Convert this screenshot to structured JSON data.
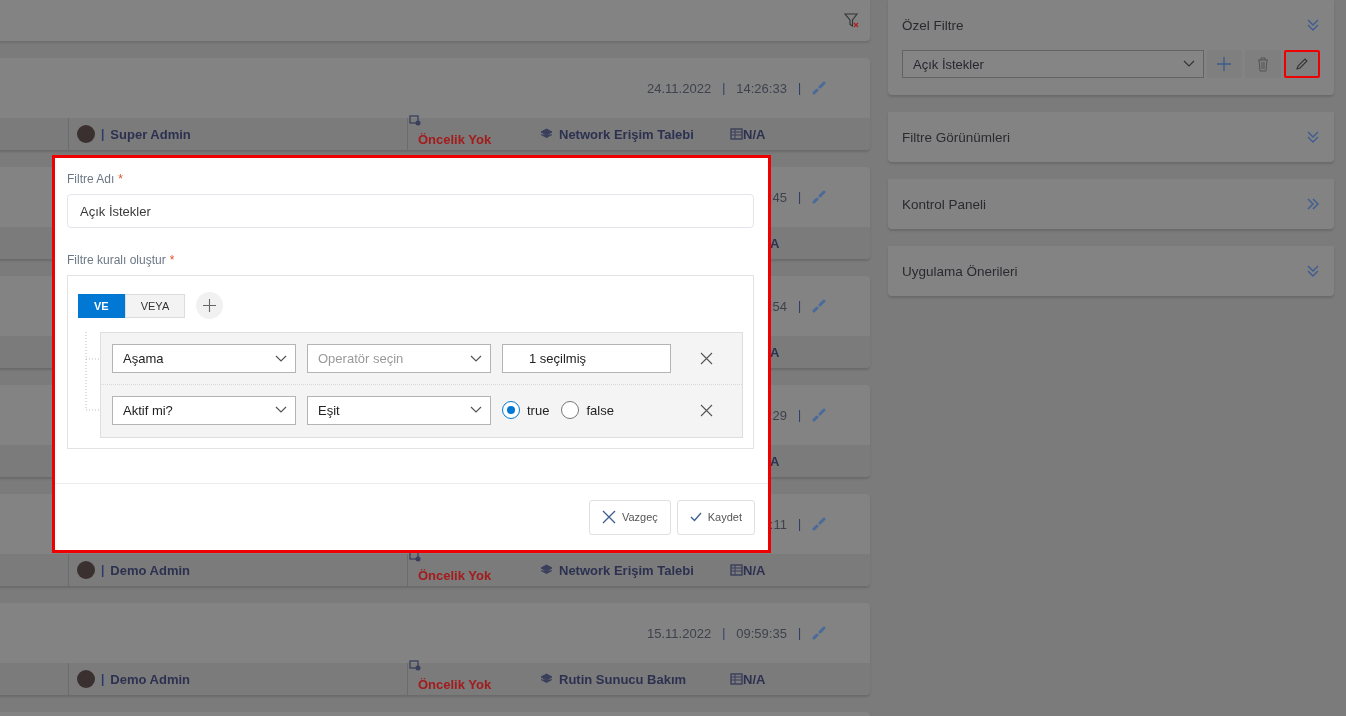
{
  "cards": [
    {
      "date": "24.11.2022",
      "date_sep": "|",
      "time": "14:26:33",
      "time_sep": "|",
      "bottom": {
        "kind": "full",
        "user_sep": "|",
        "user": "Super Admin",
        "priority": "Öncelik Yok",
        "type": "Network Erişim Talebi",
        "code": "N/A"
      }
    },
    {
      "time": ":45",
      "time_sep": "|",
      "bottom": {
        "kind": "tail",
        "text": "A"
      }
    },
    {
      "time": ":54",
      "time_sep": "|",
      "bottom": {
        "kind": "tail",
        "text": "A"
      }
    },
    {
      "time": ":29",
      "time_sep": "|",
      "bottom": {
        "kind": "tail",
        "text": "A"
      }
    },
    {
      "time": ":11",
      "time_sep": "|",
      "bottom": {
        "kind": "full",
        "user_sep": "|",
        "user": "Demo Admin",
        "priority": "Öncelik Yok",
        "type": "Network Erişim Talebi",
        "code": "N/A"
      }
    },
    {
      "date": "15.11.2022",
      "date_sep": "|",
      "time": "09:59:35",
      "time_sep": "|",
      "bottom": {
        "kind": "full",
        "user_sep": "|",
        "user": "Demo Admin",
        "priority": "Öncelik Yok",
        "type": "Rutin Sunucu Bakım",
        "code": "N/A"
      }
    },
    {
      "bottom": {
        "kind": "none"
      }
    }
  ],
  "side_panels": [
    {
      "title": "Özel Filtre",
      "kind": "collapsible",
      "filter_select": "Açık İstekler"
    },
    {
      "title": "Filtre Görünümleri",
      "kind": "collapsible"
    },
    {
      "title": "Kontrol Paneli",
      "kind": "link"
    },
    {
      "title": "Uygulama Önerileri",
      "kind": "collapsible"
    }
  ],
  "modal": {
    "name_label": "Filtre Adı",
    "name_required": "*",
    "name_value": "Açık İstekler",
    "rule_label": "Filtre kuralı oluştur",
    "rule_required": "*",
    "combinators": [
      {
        "label": "VE",
        "selected": true
      },
      {
        "label": "VEYA",
        "selected": false
      }
    ],
    "rules": [
      {
        "field": "Aşama",
        "operator": {
          "placeholder": "Operatör seçin"
        },
        "value": {
          "kind": "text",
          "text": "1 seçilmiş"
        }
      },
      {
        "field": "Aktif mi?",
        "operator": {
          "value": "Eşit"
        },
        "value": {
          "kind": "radio",
          "options": [
            {
              "label": "true",
              "selected": true
            },
            {
              "label": "false",
              "selected": false
            }
          ]
        }
      }
    ],
    "buttons": [
      {
        "kind": "cancel",
        "label": "Vazgeç"
      },
      {
        "kind": "save",
        "label": "Kaydet"
      }
    ]
  }
}
